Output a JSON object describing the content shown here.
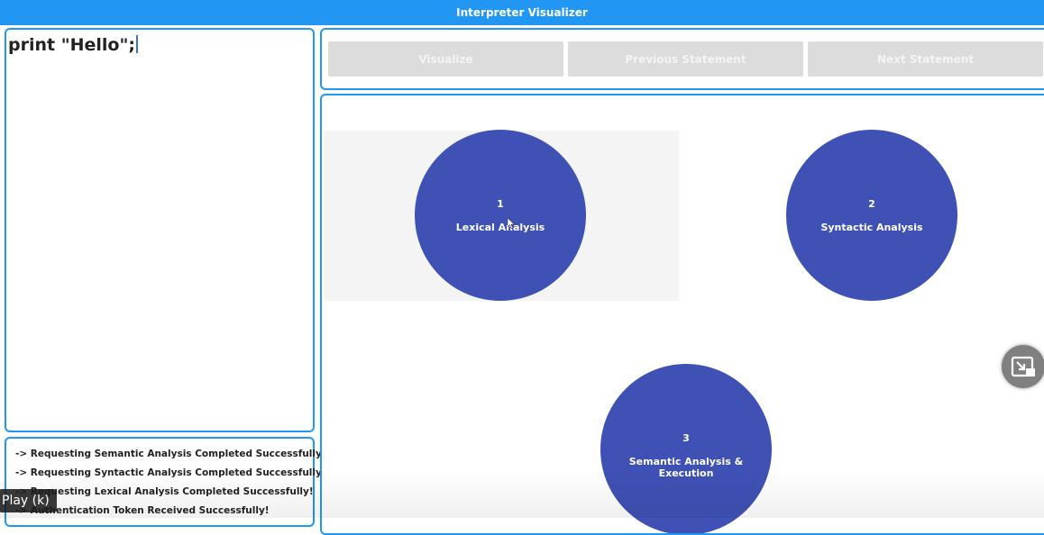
{
  "app": {
    "title": "Interpreter Visualizer"
  },
  "editor": {
    "code": "print \"Hello\";"
  },
  "toolbar": {
    "visualize_label": "Visualize",
    "previous_label": "Previous Statement",
    "next_label": "Next Statement"
  },
  "stages": [
    {
      "number": "1",
      "label": "Lexical Analysis"
    },
    {
      "number": "2",
      "label": "Syntactic Analysis"
    },
    {
      "number": "3",
      "label": "Semantic Analysis & Execution"
    }
  ],
  "log": [
    "-> Requesting Semantic Analysis Completed Successfully!",
    "-> Requesting Syntactic Analysis Completed Successfully!",
    "-> Requesting Lexical Analysis Completed Successfully!",
    "-> Authentication Token Received Successfully!"
  ],
  "overlay": {
    "tooltip": "Play (k)"
  },
  "colors": {
    "accent": "#2196f3",
    "node": "#3f51b5",
    "button_bg": "#dcdcdc"
  },
  "icons": {
    "pip": "picture-in-picture-icon",
    "cursor": "mouse-cursor-icon"
  }
}
